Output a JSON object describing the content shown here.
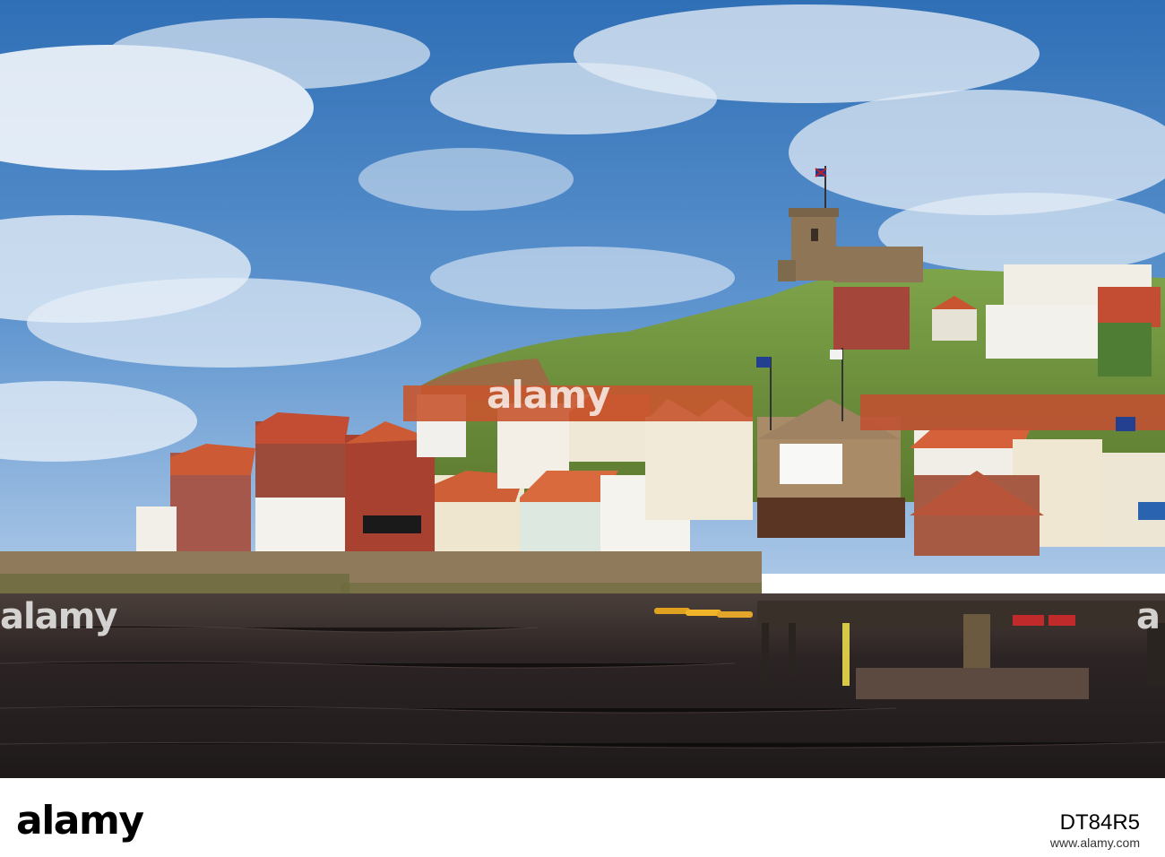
{
  "watermark": {
    "main": "alamy",
    "side_left": "alamy",
    "side_right": "a"
  },
  "footer": {
    "brand": "alamy",
    "image_id": "DT84R5",
    "url": "www.alamy.com"
  },
  "colors": {
    "sky_top": "#2f6fb6",
    "sky_low": "#8fb8de",
    "water": "#2c2424",
    "roof": "#c8552f",
    "grass": "#6f8f3a"
  }
}
